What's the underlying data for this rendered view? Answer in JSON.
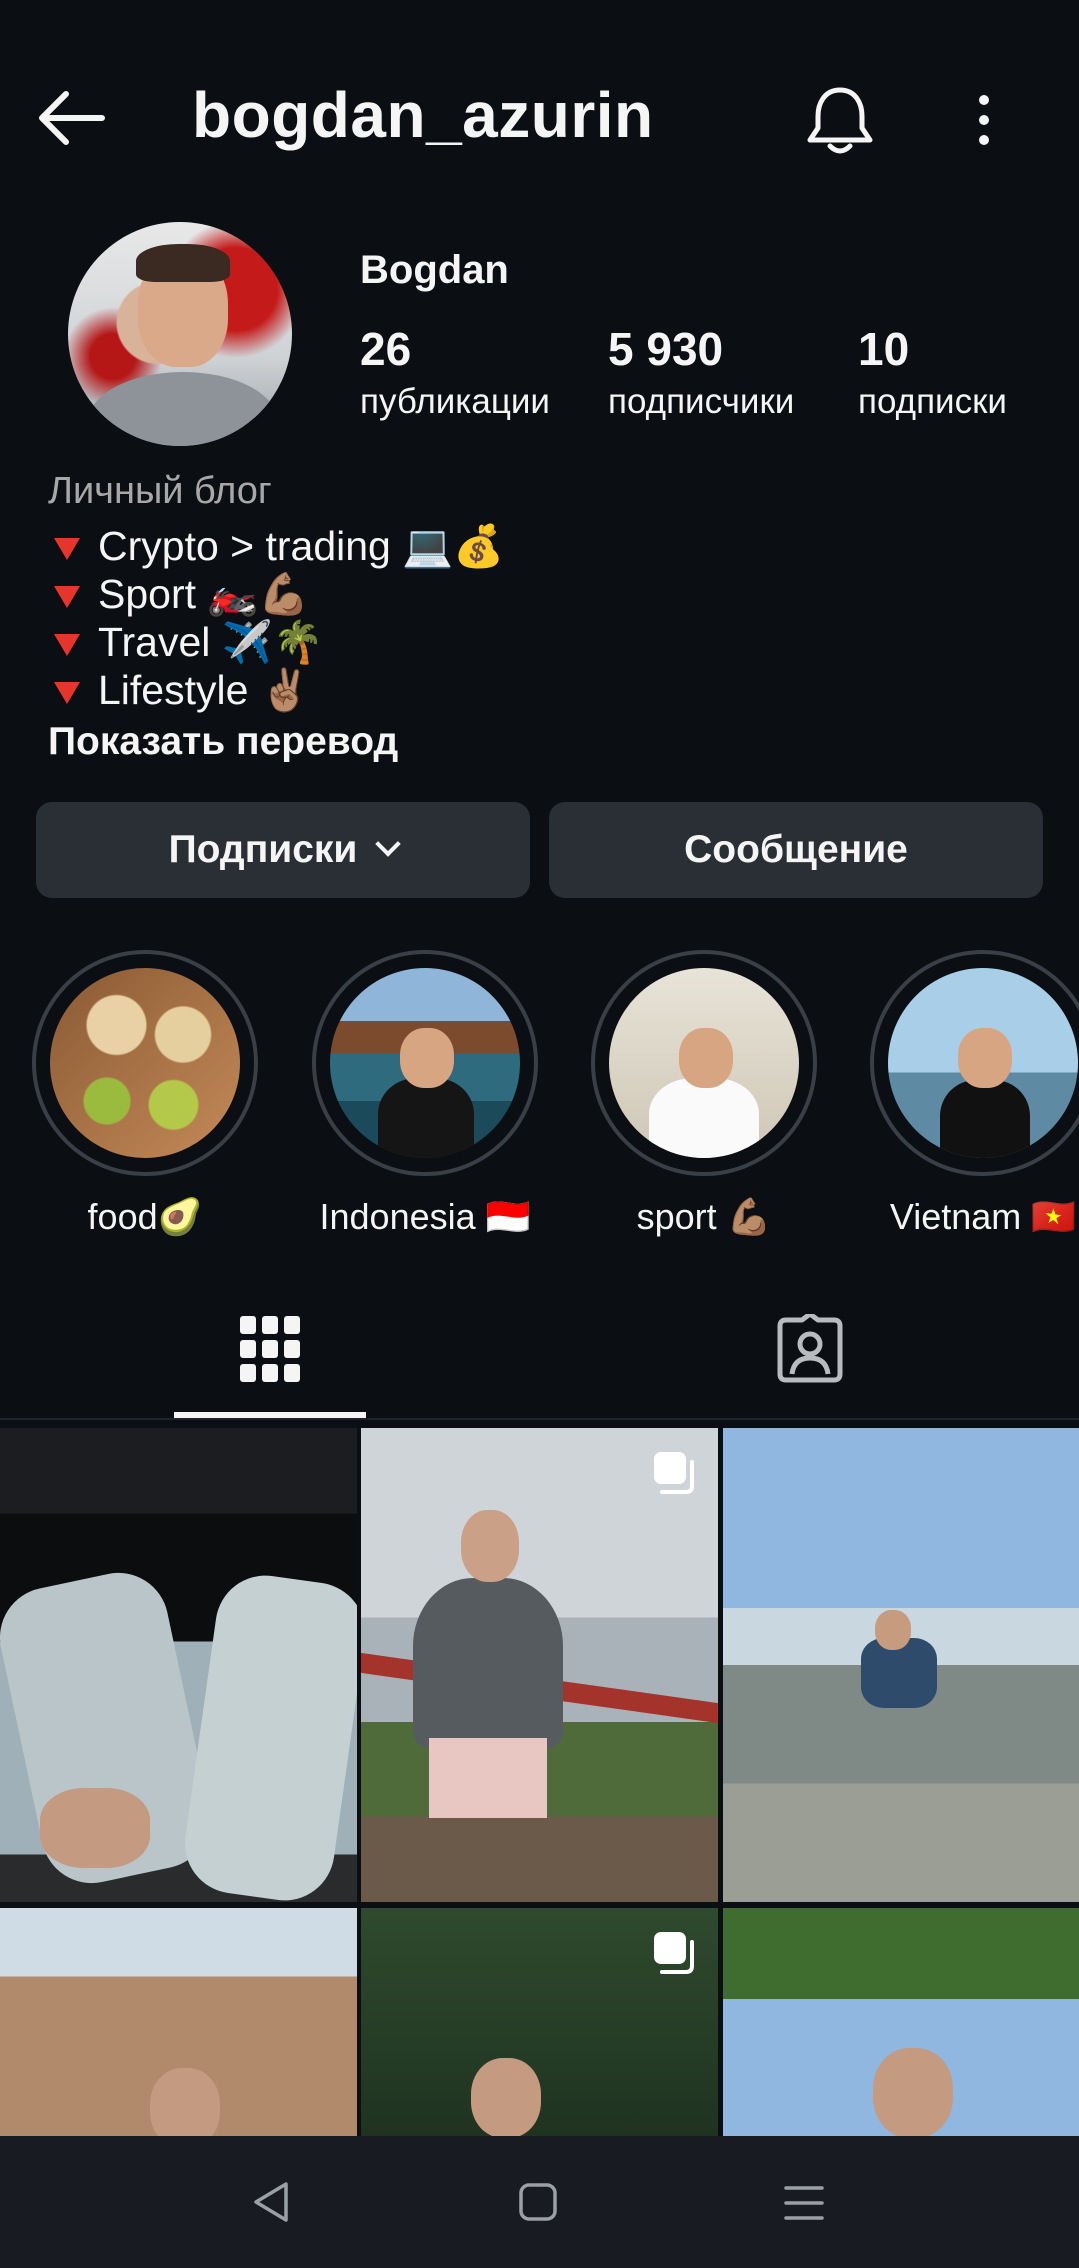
{
  "header": {
    "username": "bogdan_azurin"
  },
  "profile": {
    "display_name": "Bogdan",
    "stats": [
      {
        "value": "26",
        "label": "публикации"
      },
      {
        "value": "5 930",
        "label": "подписчики"
      },
      {
        "value": "10",
        "label": "подписки"
      }
    ],
    "bio": {
      "category": "Личный блог",
      "lines": [
        "Crypto > trading 💻💰",
        "Sport 🏍️💪🏽",
        "Travel ✈️🌴",
        "Lifestyle ✌🏽"
      ],
      "show_translation": "Показать перевод"
    }
  },
  "actions": {
    "following_label": "Подписки",
    "message_label": "Сообщение"
  },
  "highlights": [
    {
      "label": "food🥑"
    },
    {
      "label": "Indonesia 🇮🇩"
    },
    {
      "label": "sport 💪🏽"
    },
    {
      "label": "Vietnam 🇻🇳"
    }
  ],
  "tabs": [
    {
      "icon": "grid-icon",
      "active": true
    },
    {
      "icon": "tagged-icon",
      "active": false
    }
  ],
  "posts": [
    {
      "multi": false
    },
    {
      "multi": true
    },
    {
      "multi": false
    },
    {
      "multi": false
    },
    {
      "multi": true
    },
    {
      "multi": false
    }
  ],
  "colors": {
    "background": "#0b0f14",
    "button": "#2a2f35",
    "bullet": "#e8352b",
    "muted_text": "#a8a8a8"
  }
}
